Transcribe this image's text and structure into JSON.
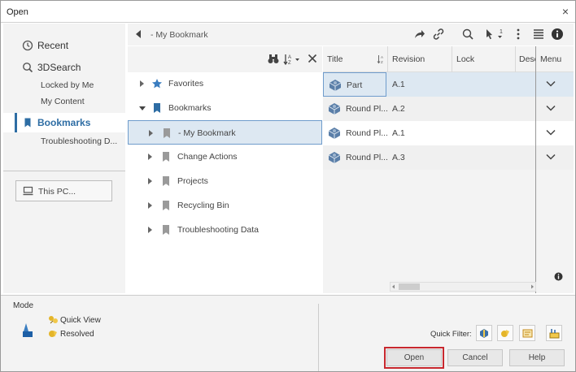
{
  "window": {
    "title": "Open",
    "close_glyph": "×"
  },
  "nav": {
    "items": [
      {
        "label": "Recent",
        "icon": "clock-icon"
      },
      {
        "label": "3DSearch",
        "icon": "search-icon"
      }
    ],
    "sub_items": [
      "Locked by Me",
      "My Content"
    ],
    "active": {
      "label": "Bookmarks",
      "icon": "bookmark-icon"
    },
    "sub_items_after": [
      "Troubleshooting D..."
    ],
    "this_pc": "This PC..."
  },
  "topbar": {
    "breadcrumb": "- My Bookmark"
  },
  "tree": {
    "rows": [
      {
        "label": "Favorites"
      },
      {
        "label": "Bookmarks"
      },
      {
        "label": "- My Bookmark"
      },
      {
        "label": "Change Actions"
      },
      {
        "label": "Projects"
      },
      {
        "label": "Recycling Bin"
      },
      {
        "label": "Troubleshooting Data"
      }
    ]
  },
  "grid": {
    "columns": [
      "Title",
      "Revision",
      "Lock",
      "Desc",
      "Menu"
    ],
    "rows": [
      {
        "title": "Part",
        "revision": "A.1"
      },
      {
        "title": "Round Pl...",
        "revision": "A.2"
      },
      {
        "title": "Round Pl...",
        "revision": "A.1"
      },
      {
        "title": "Round Pl...",
        "revision": "A.3"
      }
    ]
  },
  "bottom": {
    "mode_label": "Mode",
    "quick_view": "Quick View",
    "resolved": "Resolved",
    "quick_filter": "Quick Filter:",
    "buttons": {
      "open": "Open",
      "cancel": "Cancel",
      "help": "Help"
    }
  },
  "colors": {
    "accent": "#2e6da4",
    "selection": "#dde8f2",
    "highlight": "#c8282e"
  }
}
